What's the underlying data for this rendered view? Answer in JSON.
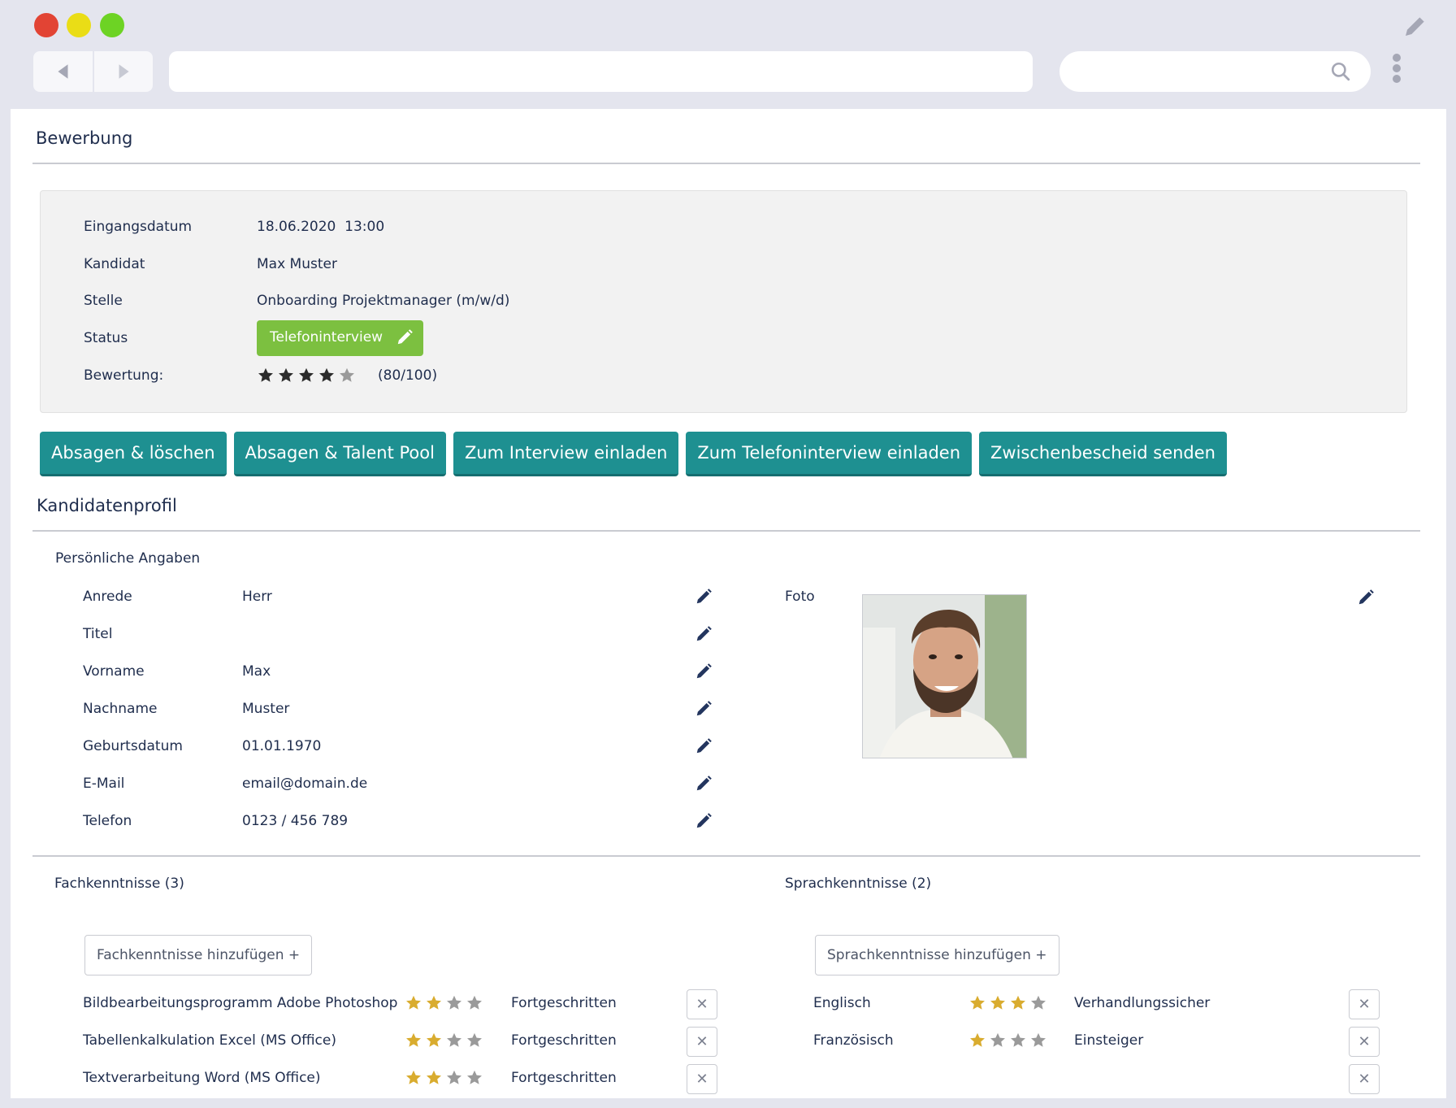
{
  "browser": {
    "url": "",
    "search": ""
  },
  "application": {
    "section_title": "Bewerbung",
    "info": {
      "received_label": "Eingangsdatum",
      "received_value": "18.06.2020  13:00",
      "candidate_label": "Kandidat",
      "candidate_value": "Max Muster",
      "position_label": "Stelle",
      "position_value": "Onboarding Projektmanager (m/w/d)",
      "status_label": "Status",
      "status_value": "Telefoninterview",
      "rating_label": "Bewertung:",
      "rating_stars": 4,
      "rating_max": 5,
      "rating_text": "(80/100)"
    },
    "actions": [
      "Absagen & löschen",
      "Absagen & Talent Pool",
      "Zum Interview einladen",
      "Zum Telefoninterview einladen",
      "Zwischenbescheid senden"
    ]
  },
  "profile": {
    "section_title": "Kandidatenprofil",
    "personal_title": "Persönliche Angaben",
    "fields": [
      {
        "label": "Anrede",
        "value": "Herr"
      },
      {
        "label": "Titel",
        "value": ""
      },
      {
        "label": "Vorname",
        "value": "Max"
      },
      {
        "label": "Nachname",
        "value": "Muster"
      },
      {
        "label": "Geburtsdatum",
        "value": "01.01.1970"
      },
      {
        "label": "E-Mail",
        "value": "email@domain.de"
      },
      {
        "label": "Telefon",
        "value": "0123 / 456 789"
      }
    ],
    "photo_label": "Foto"
  },
  "skills": {
    "title": "Fachkenntnisse (3)",
    "add_label": "Fachkenntnisse hinzufügen +",
    "items": [
      {
        "name": "Bildbearbeitungsprogramm Adobe Photoshop",
        "stars": 2,
        "level": "Fortgeschritten"
      },
      {
        "name": "Tabellenkalkulation Excel (MS Office)",
        "stars": 2,
        "level": "Fortgeschritten"
      },
      {
        "name": "Textverarbeitung Word (MS Office)",
        "stars": 2,
        "level": "Fortgeschritten"
      }
    ]
  },
  "languages": {
    "title": "Sprachkenntnisse (2)",
    "add_label": "Sprachkenntnisse hinzufügen +",
    "items": [
      {
        "name": "Englisch",
        "stars": 3,
        "level": "Verhandlungssicher"
      },
      {
        "name": "Französisch",
        "stars": 1,
        "level": "Einsteiger"
      }
    ]
  },
  "colors": {
    "accent": "#1e9091",
    "status_green": "#7cc040",
    "star_gold": "#d9ac2f",
    "star_dark": "#2c2c2c",
    "star_grey": "#9a9a9a"
  },
  "icons": [
    "back-icon",
    "forward-icon",
    "search-icon",
    "kebab-icon",
    "pencil-icon",
    "close-icon",
    "star-icon"
  ]
}
